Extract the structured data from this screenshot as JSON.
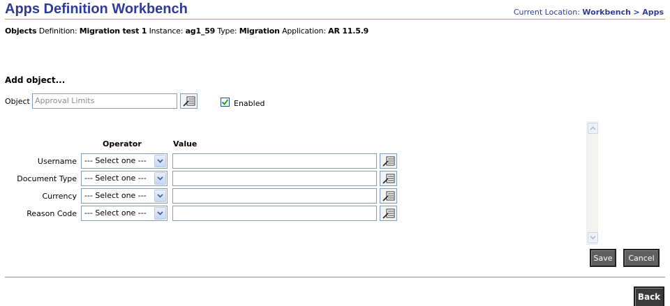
{
  "header": {
    "title": "Apps Definition Workbench",
    "breadcrumb_prefix": "Current Location:",
    "breadcrumb_parent": "Workbench",
    "breadcrumb_separator": ">",
    "breadcrumb_current": "Apps"
  },
  "meta": {
    "objects_label": "Objects",
    "definition_label": "Definition:",
    "definition_value": "Migration test 1",
    "instance_label": "Instance:",
    "instance_value": "ag1_59",
    "type_label": "Type:",
    "type_value": "Migration",
    "application_label": "Application:",
    "application_value": "AR 11.5.9"
  },
  "add_object": {
    "section_title": "Add object...",
    "object_label": "Object",
    "object_value": "Approval Limits",
    "enabled_label": "Enabled",
    "enabled_checked": true
  },
  "criteria": {
    "operator_header": "Operator",
    "value_header": "Value",
    "rows": [
      {
        "label": "Username",
        "operator": "--- Select one ---",
        "value": ""
      },
      {
        "label": "Document Type",
        "operator": "--- Select one ---",
        "value": ""
      },
      {
        "label": "Currency",
        "operator": "--- Select one ---",
        "value": ""
      },
      {
        "label": "Reason Code",
        "operator": "--- Select one ---",
        "value": ""
      }
    ]
  },
  "buttons": {
    "save": "Save",
    "cancel": "Cancel",
    "back": "Back"
  },
  "colors": {
    "title": "#2f3c97",
    "title_rule": "#c7a04e",
    "button_bg": "#5f5f5f"
  }
}
